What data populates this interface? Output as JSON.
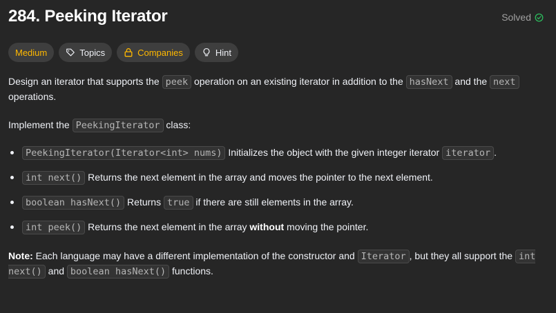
{
  "header": {
    "title": "284. Peeking Iterator",
    "status_label": "Solved"
  },
  "tags": {
    "difficulty": "Medium",
    "topics": "Topics",
    "companies": "Companies",
    "hint": "Hint"
  },
  "description": {
    "p1_a": "Design an iterator that supports the ",
    "p1_code1": "peek",
    "p1_b": " operation on an existing iterator in addition to the ",
    "p1_code2": "hasNext",
    "p1_c": " and the ",
    "p1_code3": "next",
    "p1_d": " operations.",
    "p2_a": "Implement the ",
    "p2_code": "PeekingIterator",
    "p2_b": " class:",
    "items": [
      {
        "code": "PeekingIterator(Iterator<int> nums)",
        "text": " Initializes the object with the given integer iterator ",
        "code2": "iterator",
        "text2": "."
      },
      {
        "code": "int next()",
        "text": " Returns the next element in the array and moves the pointer to the next element."
      },
      {
        "code": "boolean hasNext()",
        "text": " Returns ",
        "code2": "true",
        "text2": " if there are still elements in the array."
      },
      {
        "code": "int peek()",
        "text": " Returns the next element in the array ",
        "bold": "without",
        "text2": " moving the pointer."
      }
    ],
    "note_label": "Note:",
    "note_a": " Each language may have a different implementation of the constructor and ",
    "note_code1": "Iterator",
    "note_b": ", but they all support the ",
    "note_code2": "int next()",
    "note_c": " and ",
    "note_code3": "boolean hasNext()",
    "note_d": " functions."
  },
  "colors": {
    "background": "#262626",
    "accent_medium": "#ffb800",
    "solved_check": "#2cbb5d"
  }
}
